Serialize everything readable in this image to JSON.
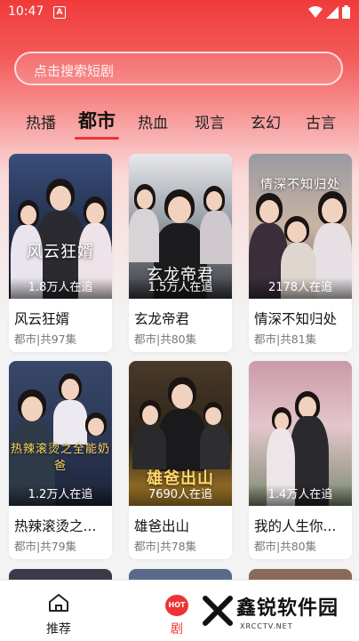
{
  "status_bar": {
    "time": "10:47",
    "notification_icon": "A"
  },
  "search": {
    "placeholder": "点击搜索短剧"
  },
  "tabs": [
    {
      "label": "热播",
      "active": false
    },
    {
      "label": "都市",
      "active": true
    },
    {
      "label": "热血",
      "active": false
    },
    {
      "label": "现言",
      "active": false
    },
    {
      "label": "玄幻",
      "active": false
    },
    {
      "label": "古言",
      "active": false
    }
  ],
  "dramas": [
    {
      "poster_title": "风云狂婿",
      "watchers": "1.8万人在追",
      "title": "风云狂婿",
      "meta": "都市|共97集"
    },
    {
      "poster_title": "玄龙帝君",
      "watchers": "1.5万人在追",
      "title": "玄龙帝君",
      "meta": "都市|共80集"
    },
    {
      "poster_title": "情深不知归处",
      "watchers": "2178人在追",
      "title": "情深不知归处",
      "meta": "都市|共81集"
    },
    {
      "poster_title": "热辣滚烫之全能奶爸",
      "watchers": "1.2万人在追",
      "title": "热辣滚烫之...",
      "meta": "都市|共79集"
    },
    {
      "poster_title": "雄爸出山",
      "watchers": "7690人在追",
      "title": "雄爸出山",
      "meta": "都市|共78集"
    },
    {
      "poster_title": "",
      "watchers": "1.4万人在追",
      "title": "我的人生你...",
      "meta": "都市|共80集"
    }
  ],
  "bottom_nav": [
    {
      "label": "推荐",
      "icon": "home-icon"
    },
    {
      "label": "剧",
      "icon": "hot-badge-icon"
    }
  ],
  "watermark": {
    "text": "鑫锐软件园",
    "sub": "XRCCTV.NET"
  }
}
